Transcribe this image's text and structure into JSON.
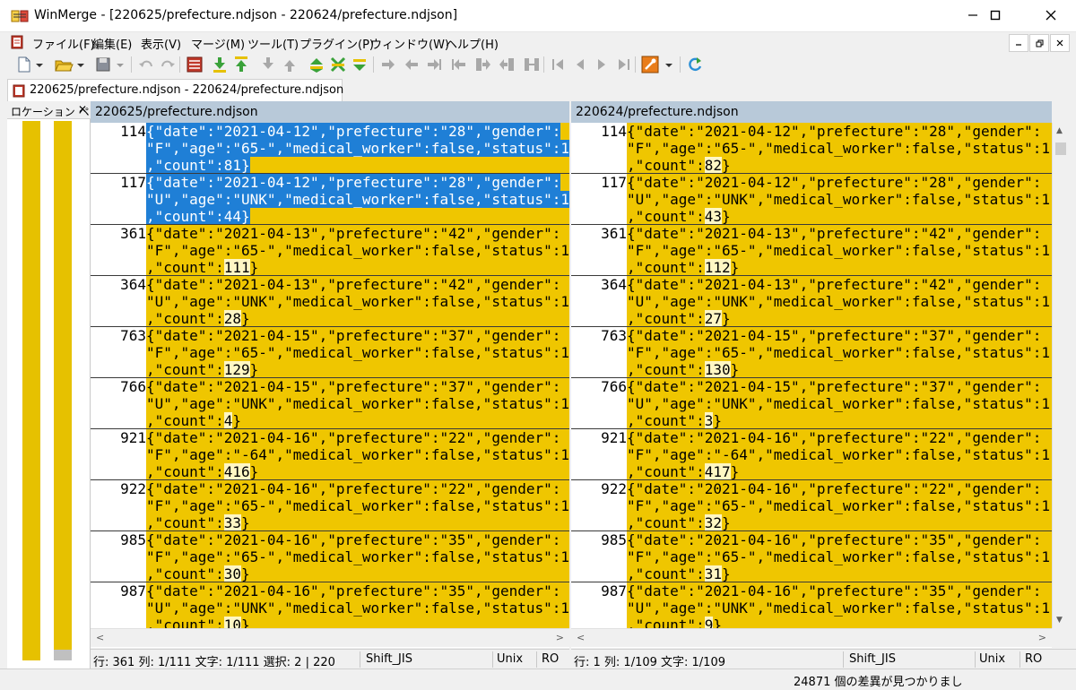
{
  "window": {
    "title": "WinMerge - [220625/prefecture.ndjson - 220624/prefecture.ndjson]"
  },
  "menu": {
    "items": [
      "ファイル(F)",
      "編集(E)",
      "表示(V)",
      "マージ(M)",
      "ツール(T)",
      "プラグイン(P)",
      "ウィンドウ(W)",
      "ヘルプ(H)"
    ]
  },
  "tab": {
    "label": "220625/prefecture.ndjson - 220624/prefecture.ndjson"
  },
  "location_pane": {
    "title": "ロケーション ペ"
  },
  "left_pane": {
    "header": "220625/prefecture.ndjson",
    "rows": [
      {
        "num": "114",
        "l1": "{\"date\":\"2021-04-12\",\"prefecture\":\"28\",\"gender\":",
        "l2": "\"F\",\"age\":\"65-\",\"medical_worker\":false,\"status\":1",
        "l3a": ",\"count\":",
        "l3b": "81",
        "l3c": "}"
      },
      {
        "num": "117",
        "l1": "{\"date\":\"2021-04-12\",\"prefecture\":\"28\",\"gender\":",
        "l2": "\"U\",\"age\":\"UNK\",\"medical_worker\":false,\"status\":1",
        "l3a": ",\"count\":",
        "l3b": "44",
        "l3c": "}"
      },
      {
        "num": "361",
        "l1": "{\"date\":\"2021-04-13\",\"prefecture\":\"42\",\"gender\":",
        "l2": "\"F\",\"age\":\"65-\",\"medical_worker\":false,\"status\":1",
        "l3a": ",\"count\":",
        "l3b": "111",
        "l3c": "}"
      },
      {
        "num": "364",
        "l1": "{\"date\":\"2021-04-13\",\"prefecture\":\"42\",\"gender\":",
        "l2": "\"U\",\"age\":\"UNK\",\"medical_worker\":false,\"status\":1",
        "l3a": ",\"count\":",
        "l3b": "28",
        "l3c": "}"
      },
      {
        "num": "763",
        "l1": "{\"date\":\"2021-04-15\",\"prefecture\":\"37\",\"gender\":",
        "l2": "\"F\",\"age\":\"65-\",\"medical_worker\":false,\"status\":1",
        "l3a": ",\"count\":",
        "l3b": "129",
        "l3c": "}"
      },
      {
        "num": "766",
        "l1": "{\"date\":\"2021-04-15\",\"prefecture\":\"37\",\"gender\":",
        "l2": "\"U\",\"age\":\"UNK\",\"medical_worker\":false,\"status\":1",
        "l3a": ",\"count\":",
        "l3b": "4",
        "l3c": "}"
      },
      {
        "num": "921",
        "l1": "{\"date\":\"2021-04-16\",\"prefecture\":\"22\",\"gender\":",
        "l2": "\"F\",\"age\":\"-64\",\"medical_worker\":false,\"status\":1",
        "l3a": ",\"count\":",
        "l3b": "416",
        "l3c": "}"
      },
      {
        "num": "922",
        "l1": "{\"date\":\"2021-04-16\",\"prefecture\":\"22\",\"gender\":",
        "l2": "\"F\",\"age\":\"65-\",\"medical_worker\":false,\"status\":1",
        "l3a": ",\"count\":",
        "l3b": "33",
        "l3c": "}"
      },
      {
        "num": "985",
        "l1": "{\"date\":\"2021-04-16\",\"prefecture\":\"35\",\"gender\":",
        "l2": "\"F\",\"age\":\"65-\",\"medical_worker\":false,\"status\":1",
        "l3a": ",\"count\":",
        "l3b": "30",
        "l3c": "}"
      },
      {
        "num": "987",
        "l1": "{\"date\":\"2021-04-16\",\"prefecture\":\"35\",\"gender\":",
        "l2": "\"U\",\"age\":\"UNK\",\"medical_worker\":false,\"status\":1",
        "l3a": ",\"count\":",
        "l3b": "10",
        "l3c": "}"
      }
    ]
  },
  "right_pane": {
    "header": "220624/prefecture.ndjson",
    "rows": [
      {
        "num": "114",
        "l1": "{\"date\":\"2021-04-12\",\"prefecture\":\"28\",\"gender\":",
        "l2": "\"F\",\"age\":\"65-\",\"medical_worker\":false,\"status\":1",
        "l3a": ",\"count\":",
        "l3b": "82",
        "l3c": "}"
      },
      {
        "num": "117",
        "l1": "{\"date\":\"2021-04-12\",\"prefecture\":\"28\",\"gender\":",
        "l2": "\"U\",\"age\":\"UNK\",\"medical_worker\":false,\"status\":1",
        "l3a": ",\"count\":",
        "l3b": "43",
        "l3c": "}"
      },
      {
        "num": "361",
        "l1": "{\"date\":\"2021-04-13\",\"prefecture\":\"42\",\"gender\":",
        "l2": "\"F\",\"age\":\"65-\",\"medical_worker\":false,\"status\":1",
        "l3a": ",\"count\":",
        "l3b": "112",
        "l3c": "}"
      },
      {
        "num": "364",
        "l1": "{\"date\":\"2021-04-13\",\"prefecture\":\"42\",\"gender\":",
        "l2": "\"U\",\"age\":\"UNK\",\"medical_worker\":false,\"status\":1",
        "l3a": ",\"count\":",
        "l3b": "27",
        "l3c": "}"
      },
      {
        "num": "763",
        "l1": "{\"date\":\"2021-04-15\",\"prefecture\":\"37\",\"gender\":",
        "l2": "\"F\",\"age\":\"65-\",\"medical_worker\":false,\"status\":1",
        "l3a": ",\"count\":",
        "l3b": "130",
        "l3c": "}"
      },
      {
        "num": "766",
        "l1": "{\"date\":\"2021-04-15\",\"prefecture\":\"37\",\"gender\":",
        "l2": "\"U\",\"age\":\"UNK\",\"medical_worker\":false,\"status\":1",
        "l3a": ",\"count\":",
        "l3b": "3",
        "l3c": "}"
      },
      {
        "num": "921",
        "l1": "{\"date\":\"2021-04-16\",\"prefecture\":\"22\",\"gender\":",
        "l2": "\"F\",\"age\":\"-64\",\"medical_worker\":false,\"status\":1",
        "l3a": ",\"count\":",
        "l3b": "417",
        "l3c": "}"
      },
      {
        "num": "922",
        "l1": "{\"date\":\"2021-04-16\",\"prefecture\":\"22\",\"gender\":",
        "l2": "\"F\",\"age\":\"65-\",\"medical_worker\":false,\"status\":1",
        "l3a": ",\"count\":",
        "l3b": "32",
        "l3c": "}"
      },
      {
        "num": "985",
        "l1": "{\"date\":\"2021-04-16\",\"prefecture\":\"35\",\"gender\":",
        "l2": "\"F\",\"age\":\"65-\",\"medical_worker\":false,\"status\":1",
        "l3a": ",\"count\":",
        "l3b": "31",
        "l3c": "}"
      },
      {
        "num": "987",
        "l1": "{\"date\":\"2021-04-16\",\"prefecture\":\"35\",\"gender\":",
        "l2": "\"U\",\"age\":\"UNK\",\"medical_worker\":false,\"status\":1",
        "l3a": ",\"count\":",
        "l3b": "9",
        "l3c": "}"
      }
    ]
  },
  "status_left": {
    "position": "行: 361  列: 1/111  文字: 1/111  選択: 2 | 220",
    "encoding": "Shift_JIS",
    "eol": "Unix",
    "mode": "RO"
  },
  "status_right": {
    "position": "行: 1  列: 1/109  文字: 1/109",
    "encoding": "Shift_JIS",
    "eol": "Unix",
    "mode": "RO"
  },
  "bottom_status": {
    "message": "24871 個の差異が見つかりまし"
  },
  "colors": {
    "diff_yellow": "#efc600",
    "selection_blue": "#1f7fd6",
    "header_blue_gray": "#b8c9d9"
  }
}
